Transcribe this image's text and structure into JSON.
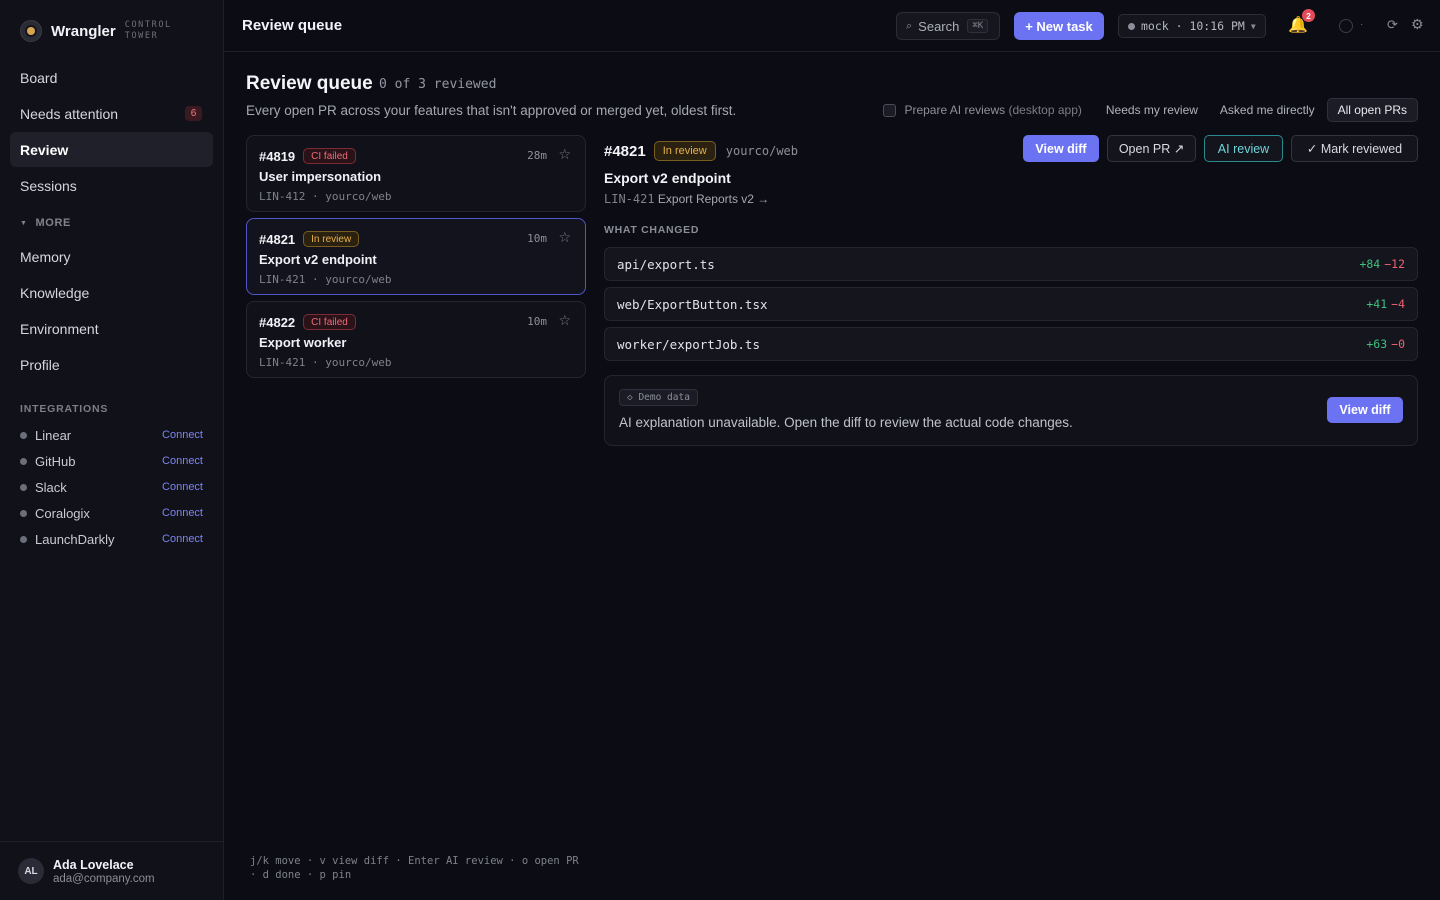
{
  "sidebar": {
    "brand_name": "Wrangler",
    "brand_sub": "CONTROL TOWER",
    "nav": [
      {
        "label": "Board"
      },
      {
        "label": "Needs attention",
        "badge": "6"
      },
      {
        "label": "Review"
      },
      {
        "label": "Sessions"
      }
    ],
    "more_label": "MORE",
    "more_nav": [
      {
        "label": "Memory"
      },
      {
        "label": "Knowledge"
      },
      {
        "label": "Environment"
      },
      {
        "label": "Profile"
      }
    ],
    "integrations_label": "INTEGRATIONS",
    "integrations": [
      {
        "name": "Linear",
        "action": "Connect"
      },
      {
        "name": "GitHub",
        "action": "Connect"
      },
      {
        "name": "Slack",
        "action": "Connect"
      },
      {
        "name": "Coralogix",
        "action": "Connect"
      },
      {
        "name": "LaunchDarkly",
        "action": "Connect"
      }
    ],
    "user": {
      "initials": "AL",
      "name": "Ada Lovelace",
      "email": "ada@company.com"
    }
  },
  "topbar": {
    "title": "Review queue",
    "search_label": "Search",
    "search_kbd": "⌘K",
    "new_task": "+ New task",
    "env_label": "mock · 10:16 PM",
    "notif_count": "2"
  },
  "main": {
    "title": "Review queue",
    "count": "0 of 3 reviewed",
    "subtitle": "Every open PR across your features that isn't approved or merged yet, oldest first.",
    "prepare_label": "Prepare AI reviews",
    "prepare_note": "(desktop app)",
    "filters": [
      "Needs my review",
      "Asked me directly",
      "All open PRs"
    ],
    "queue": [
      {
        "num": "#4819",
        "status": "CI failed",
        "age": "28m",
        "title": "User impersonation",
        "meta": "LIN-412 · yourco/web"
      },
      {
        "num": "#4821",
        "status": "In review",
        "age": "10m",
        "title": "Export v2 endpoint",
        "meta": "LIN-421 · yourco/web"
      },
      {
        "num": "#4822",
        "status": "CI failed",
        "age": "10m",
        "title": "Export worker",
        "meta": "LIN-421 · yourco/web"
      }
    ],
    "detail": {
      "num": "#4821",
      "status": "In review",
      "repo": "yourco/web",
      "actions": {
        "view_diff": "View diff",
        "open_pr": "Open PR ↗",
        "ai_review": "AI review",
        "mark_reviewed": "✓ Mark reviewed"
      },
      "title": "Export v2 endpoint",
      "ticket": "LIN-421",
      "ticket_link": "Export Reports v2 →",
      "section": "WHAT CHANGED",
      "files": [
        {
          "name": "api/export.ts",
          "add": "+84",
          "del": "−12"
        },
        {
          "name": "web/ExportButton.tsx",
          "add": "+41",
          "del": "−4"
        },
        {
          "name": "worker/exportJob.ts",
          "add": "+63",
          "del": "−0"
        }
      ],
      "demo_tag": "◇ Demo data",
      "ai_message": "AI explanation unavailable. Open the diff to review the actual code changes.",
      "ai_view_diff": "View diff"
    },
    "hints": "j/k move · v view diff · Enter AI review · o open PR · d done · p pin"
  }
}
